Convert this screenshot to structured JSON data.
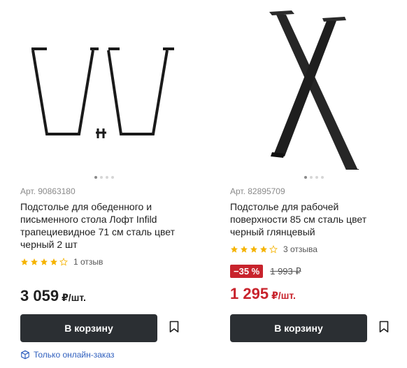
{
  "products": [
    {
      "sku": "Арт. 90863180",
      "title": "Подстолье для обеденного и письменного стола Лофт Infild трапециевидное 71 см сталь цвет черный 2 шт",
      "rating": 4,
      "reviews": "1 отзыв",
      "price": "3 059",
      "price_unit": "₽/шт.",
      "cart_label": "В корзину",
      "online_only": "Только онлайн-заказ",
      "image_icon": "trapezoid-table-legs-image"
    },
    {
      "sku": "Арт. 82895709",
      "title": "Подстолье для рабочей поверхности 85 см сталь цвет черный глянцевый",
      "rating": 4,
      "reviews": "3 отзыва",
      "discount": "−35 %",
      "old_price": "1 993 ₽",
      "price": "1 295",
      "price_unit": "₽/шт.",
      "cart_label": "В корзину",
      "image_icon": "x-shaped-table-leg-image"
    }
  ],
  "colors": {
    "button": "#2b2f33",
    "accent_red": "#c8232c",
    "star": "#f5b301",
    "link_blue": "#2f5fbe"
  }
}
